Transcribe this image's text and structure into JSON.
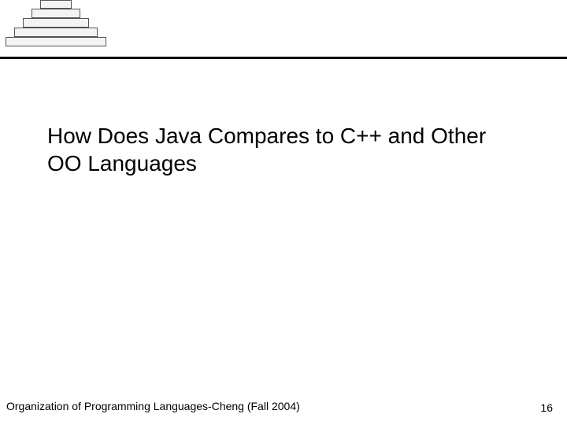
{
  "pyramid": {
    "layers": [
      "",
      "",
      "",
      "",
      ""
    ]
  },
  "title": "How Does Java Compares to C++ and Other OO Languages",
  "footer": {
    "left": "Organization of Programming Languages-Cheng (Fall 2004)",
    "page": "16"
  }
}
